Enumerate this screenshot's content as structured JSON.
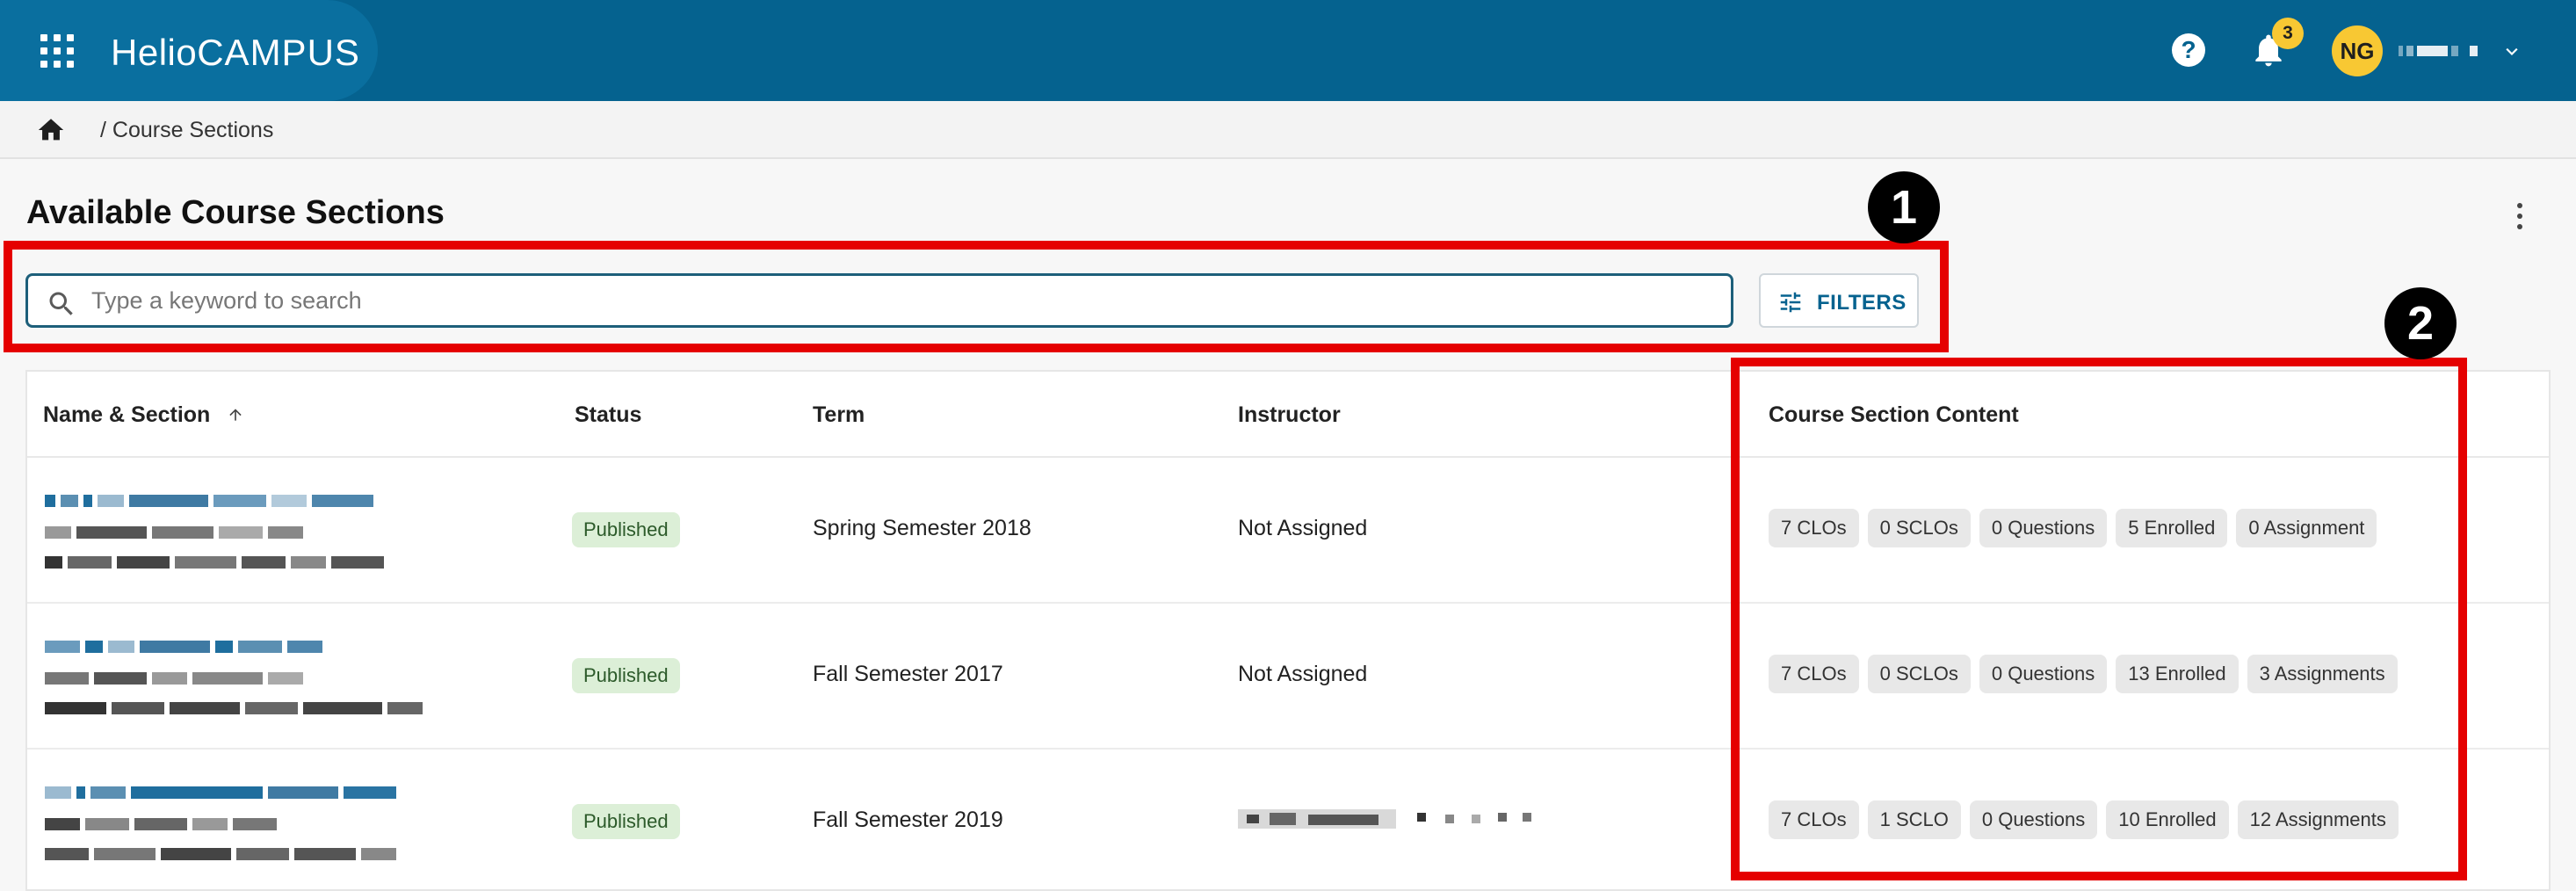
{
  "header": {
    "logo_part1": "Helio",
    "logo_part2": "CAMPUS",
    "notification_count": "3",
    "avatar_initials": "NG",
    "help_icon_glyph": "?"
  },
  "breadcrumb": {
    "separator_label": "/ Course Sections"
  },
  "page": {
    "title": "Available Course Sections"
  },
  "search": {
    "placeholder": "Type a keyword to search",
    "value": ""
  },
  "filters": {
    "label": "FILTERS"
  },
  "annotations": {
    "one": "1",
    "two": "2"
  },
  "table": {
    "columns": {
      "name": "Name & Section",
      "status": "Status",
      "term": "Term",
      "instructor": "Instructor",
      "content": "Course Section Content"
    },
    "rows": [
      {
        "status": "Published",
        "term": "Spring Semester 2018",
        "instructor": "Not Assigned",
        "chips": [
          "7 CLOs",
          "0 SCLOs",
          "0 Questions",
          "5 Enrolled",
          "0 Assignment"
        ]
      },
      {
        "status": "Published",
        "term": "Fall Semester 2017",
        "instructor": "Not Assigned",
        "chips": [
          "7 CLOs",
          "0 SCLOs",
          "0 Questions",
          "13 Enrolled",
          "3 Assignments"
        ]
      },
      {
        "status": "Published",
        "term": "Fall Semester 2019",
        "instructor": "",
        "chips": [
          "7 CLOs",
          "1 SCLO",
          "0 Questions",
          "10 Enrolled",
          "12 Assignments"
        ]
      }
    ]
  },
  "colors": {
    "header_bg": "#05628f",
    "accent_yellow": "#f8c833",
    "annotation_red": "#e50000",
    "status_green_bg": "#dcefd7"
  },
  "icons": {
    "apps": "apps-grid-icon",
    "help": "help-icon",
    "notifications": "bell-icon",
    "home": "home-icon",
    "search": "search-icon",
    "filters": "tune-icon",
    "sort": "arrow-up-icon",
    "more": "kebab-icon"
  }
}
